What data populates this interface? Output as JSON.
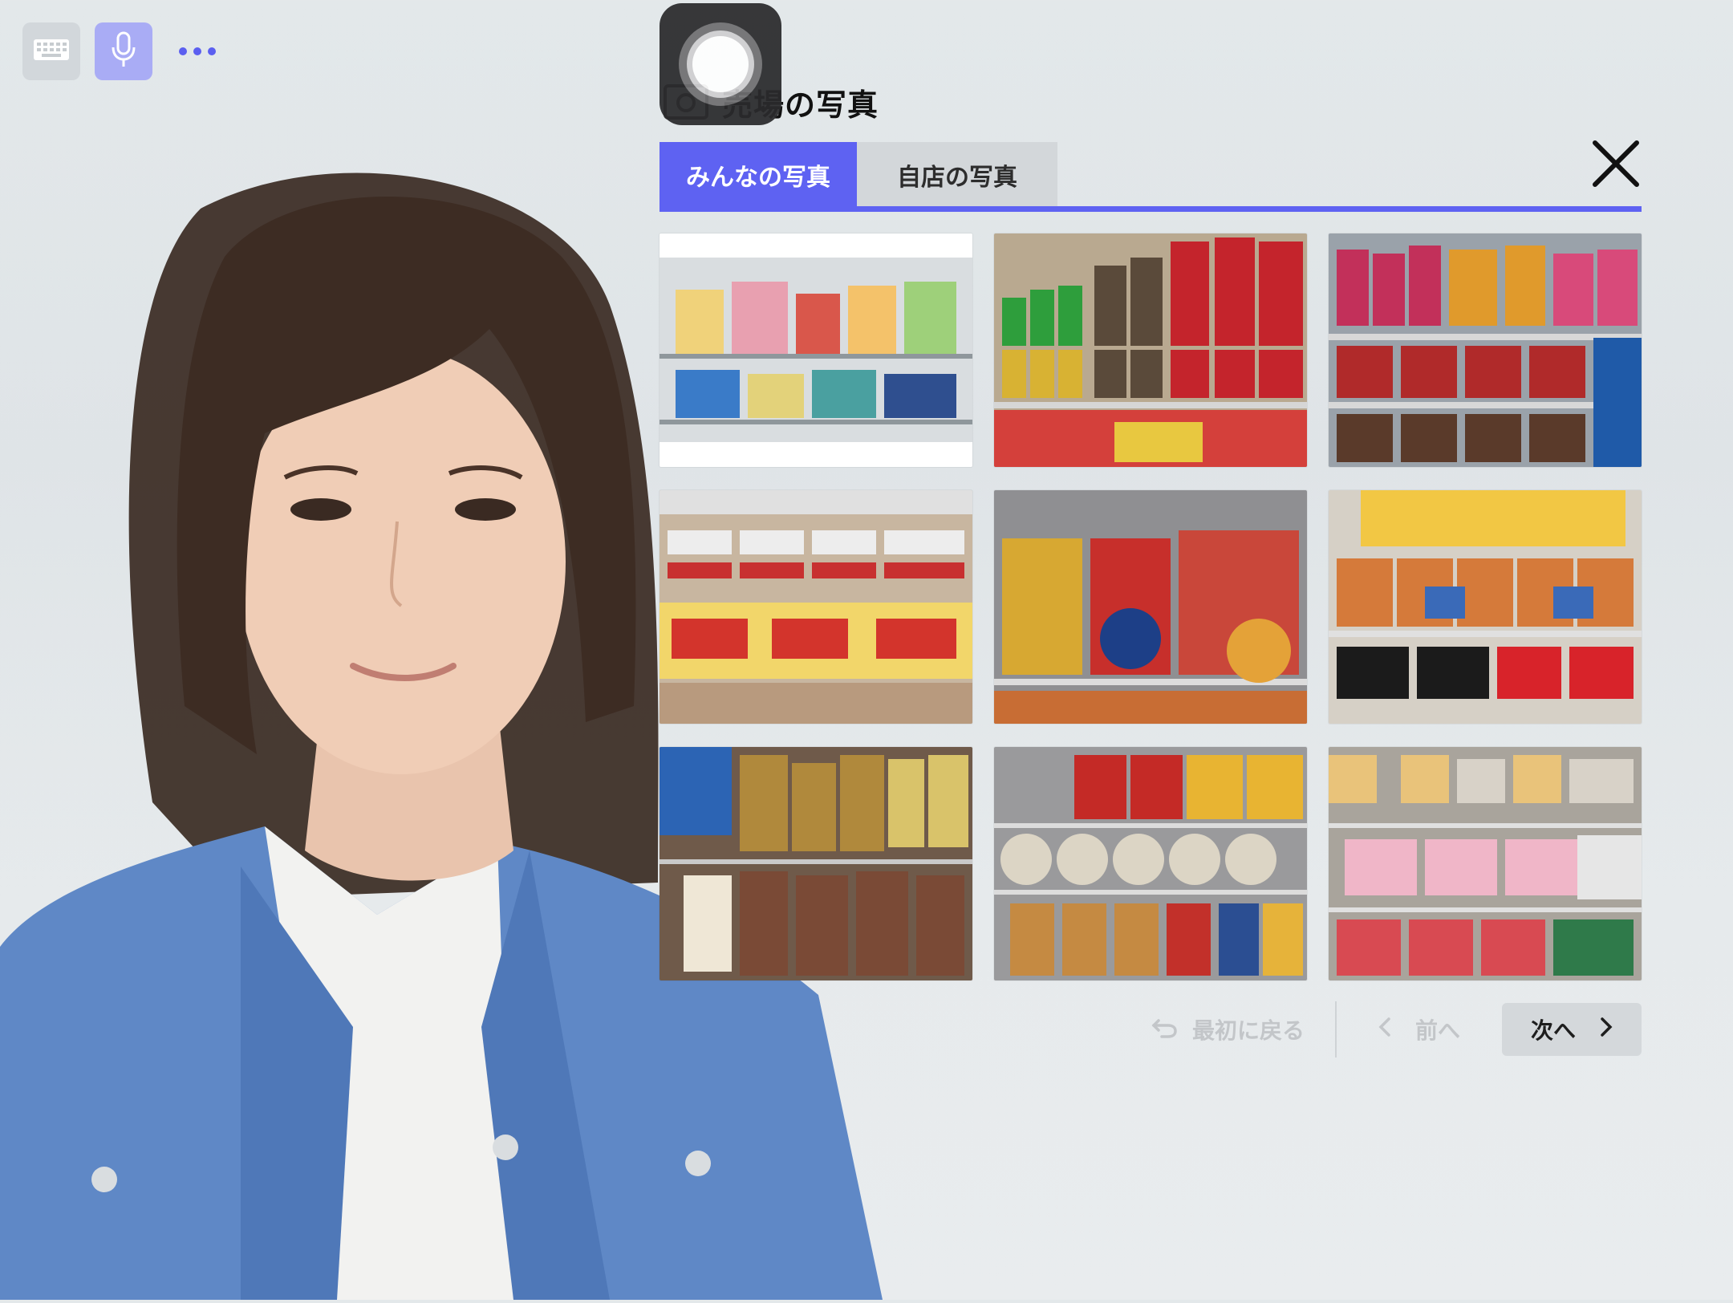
{
  "toolbar": {
    "keyboard_icon": "keyboard-icon",
    "mic_icon": "microphone-icon",
    "more_icon": "ellipsis-icon"
  },
  "title": "売場の写真",
  "tabs": [
    {
      "label": "みんなの写真",
      "active": true
    },
    {
      "label": "自店の写真",
      "active": false
    }
  ],
  "close_icon": "close-icon",
  "photos": [
    {
      "name": "photo-1"
    },
    {
      "name": "photo-2"
    },
    {
      "name": "photo-3"
    },
    {
      "name": "photo-4"
    },
    {
      "name": "photo-5"
    },
    {
      "name": "photo-6"
    },
    {
      "name": "photo-7"
    },
    {
      "name": "photo-8"
    },
    {
      "name": "photo-9"
    }
  ],
  "pager": {
    "first_label": "最初に戻る",
    "prev_label": "前へ",
    "next_label": "次へ"
  },
  "colors": {
    "accent": "#5e62f2",
    "tab_inactive": "#d3d7da",
    "disabled_text": "#c3c6c9"
  }
}
